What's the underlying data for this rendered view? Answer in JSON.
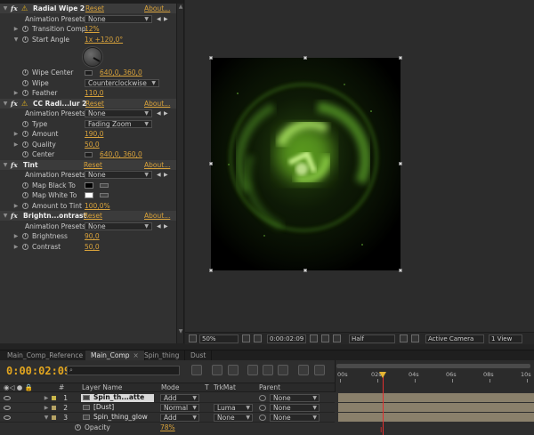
{
  "effects": [
    {
      "name": "Radial Wipe 2",
      "reset": "Reset",
      "about": "About...",
      "animation_presets_label": "Animation Presets:",
      "preset": "None",
      "props": {
        "transition_comp": {
          "label": "Transition Comp",
          "value": "12%"
        },
        "start_angle": {
          "label": "Start Angle",
          "value": "1x +120,0°"
        },
        "wipe_center": {
          "label": "Wipe Center",
          "value": "640,0, 360,0"
        },
        "wipe": {
          "label": "Wipe",
          "value": "Counterclockwise"
        },
        "feather": {
          "label": "Feather",
          "value": "110,0"
        }
      }
    },
    {
      "name": "CC Radi...lur 2",
      "reset": "Reset",
      "about": "About...",
      "animation_presets_label": "Animation Presets:",
      "preset": "None",
      "props": {
        "type": {
          "label": "Type",
          "value": "Fading Zoom"
        },
        "amount": {
          "label": "Amount",
          "value": "190,0"
        },
        "quality": {
          "label": "Quality",
          "value": "50,0"
        },
        "center": {
          "label": "Center",
          "value": "640,0, 360,0"
        }
      }
    },
    {
      "name": "Tint",
      "reset": "Reset",
      "about": "About...",
      "animation_presets_label": "Animation Presets:",
      "preset": "None",
      "props": {
        "map_black_to": {
          "label": "Map Black To",
          "color": "#000000"
        },
        "map_white_to": {
          "label": "Map White To",
          "color": "#ffffff"
        },
        "amount_to_tint": {
          "label": "Amount to Tint",
          "value": "100,0%"
        }
      }
    },
    {
      "name": "Brightn...ontrast",
      "reset": "Reset",
      "about": "About...",
      "animation_presets_label": "Animation Presets:",
      "preset": "None",
      "props": {
        "brightness": {
          "label": "Brightness",
          "value": "90,0"
        },
        "contrast": {
          "label": "Contrast",
          "value": "50,0"
        }
      }
    }
  ],
  "viewer": {
    "zoom": "50%",
    "time": "0:00:02:09",
    "resolution": "Half",
    "camera": "Active Camera",
    "views": "1 View",
    "glow_color": "#7fd62a"
  },
  "tabs": [
    {
      "label": "Main_Comp_Reference",
      "active": false
    },
    {
      "label": "Main_Comp",
      "active": true,
      "close": "×"
    },
    {
      "label": "Spin_thing",
      "active": false
    },
    {
      "label": "Dust",
      "active": false
    }
  ],
  "timeline": {
    "timecode": "0:00:02:09",
    "search_placeholder": "",
    "columns": {
      "hash": "#",
      "layer_name": "Layer Name",
      "mode": "Mode",
      "t": "T",
      "trkmat": "TrkMat",
      "parent": "Parent"
    },
    "ruler_ticks": [
      "00s",
      "02s",
      "04s",
      "06s",
      "08s",
      "10s"
    ],
    "layers": [
      {
        "num": "1",
        "name": "Spin_th...atte",
        "mode": "Add",
        "trkmat": "",
        "parent": "None",
        "color": "#c9b64a",
        "selected": true
      },
      {
        "num": "2",
        "name": "[Dust]",
        "mode": "Normal",
        "trkmat": "Luma",
        "parent": "None",
        "color": "#b5a264",
        "selected": false
      },
      {
        "num": "3",
        "name": "Spin_thing_glow",
        "mode": "Add",
        "trkmat": "None",
        "parent": "None",
        "color": "#b5a264",
        "selected": false
      }
    ],
    "opacity": {
      "label": "Opacity",
      "value": "78%"
    }
  }
}
